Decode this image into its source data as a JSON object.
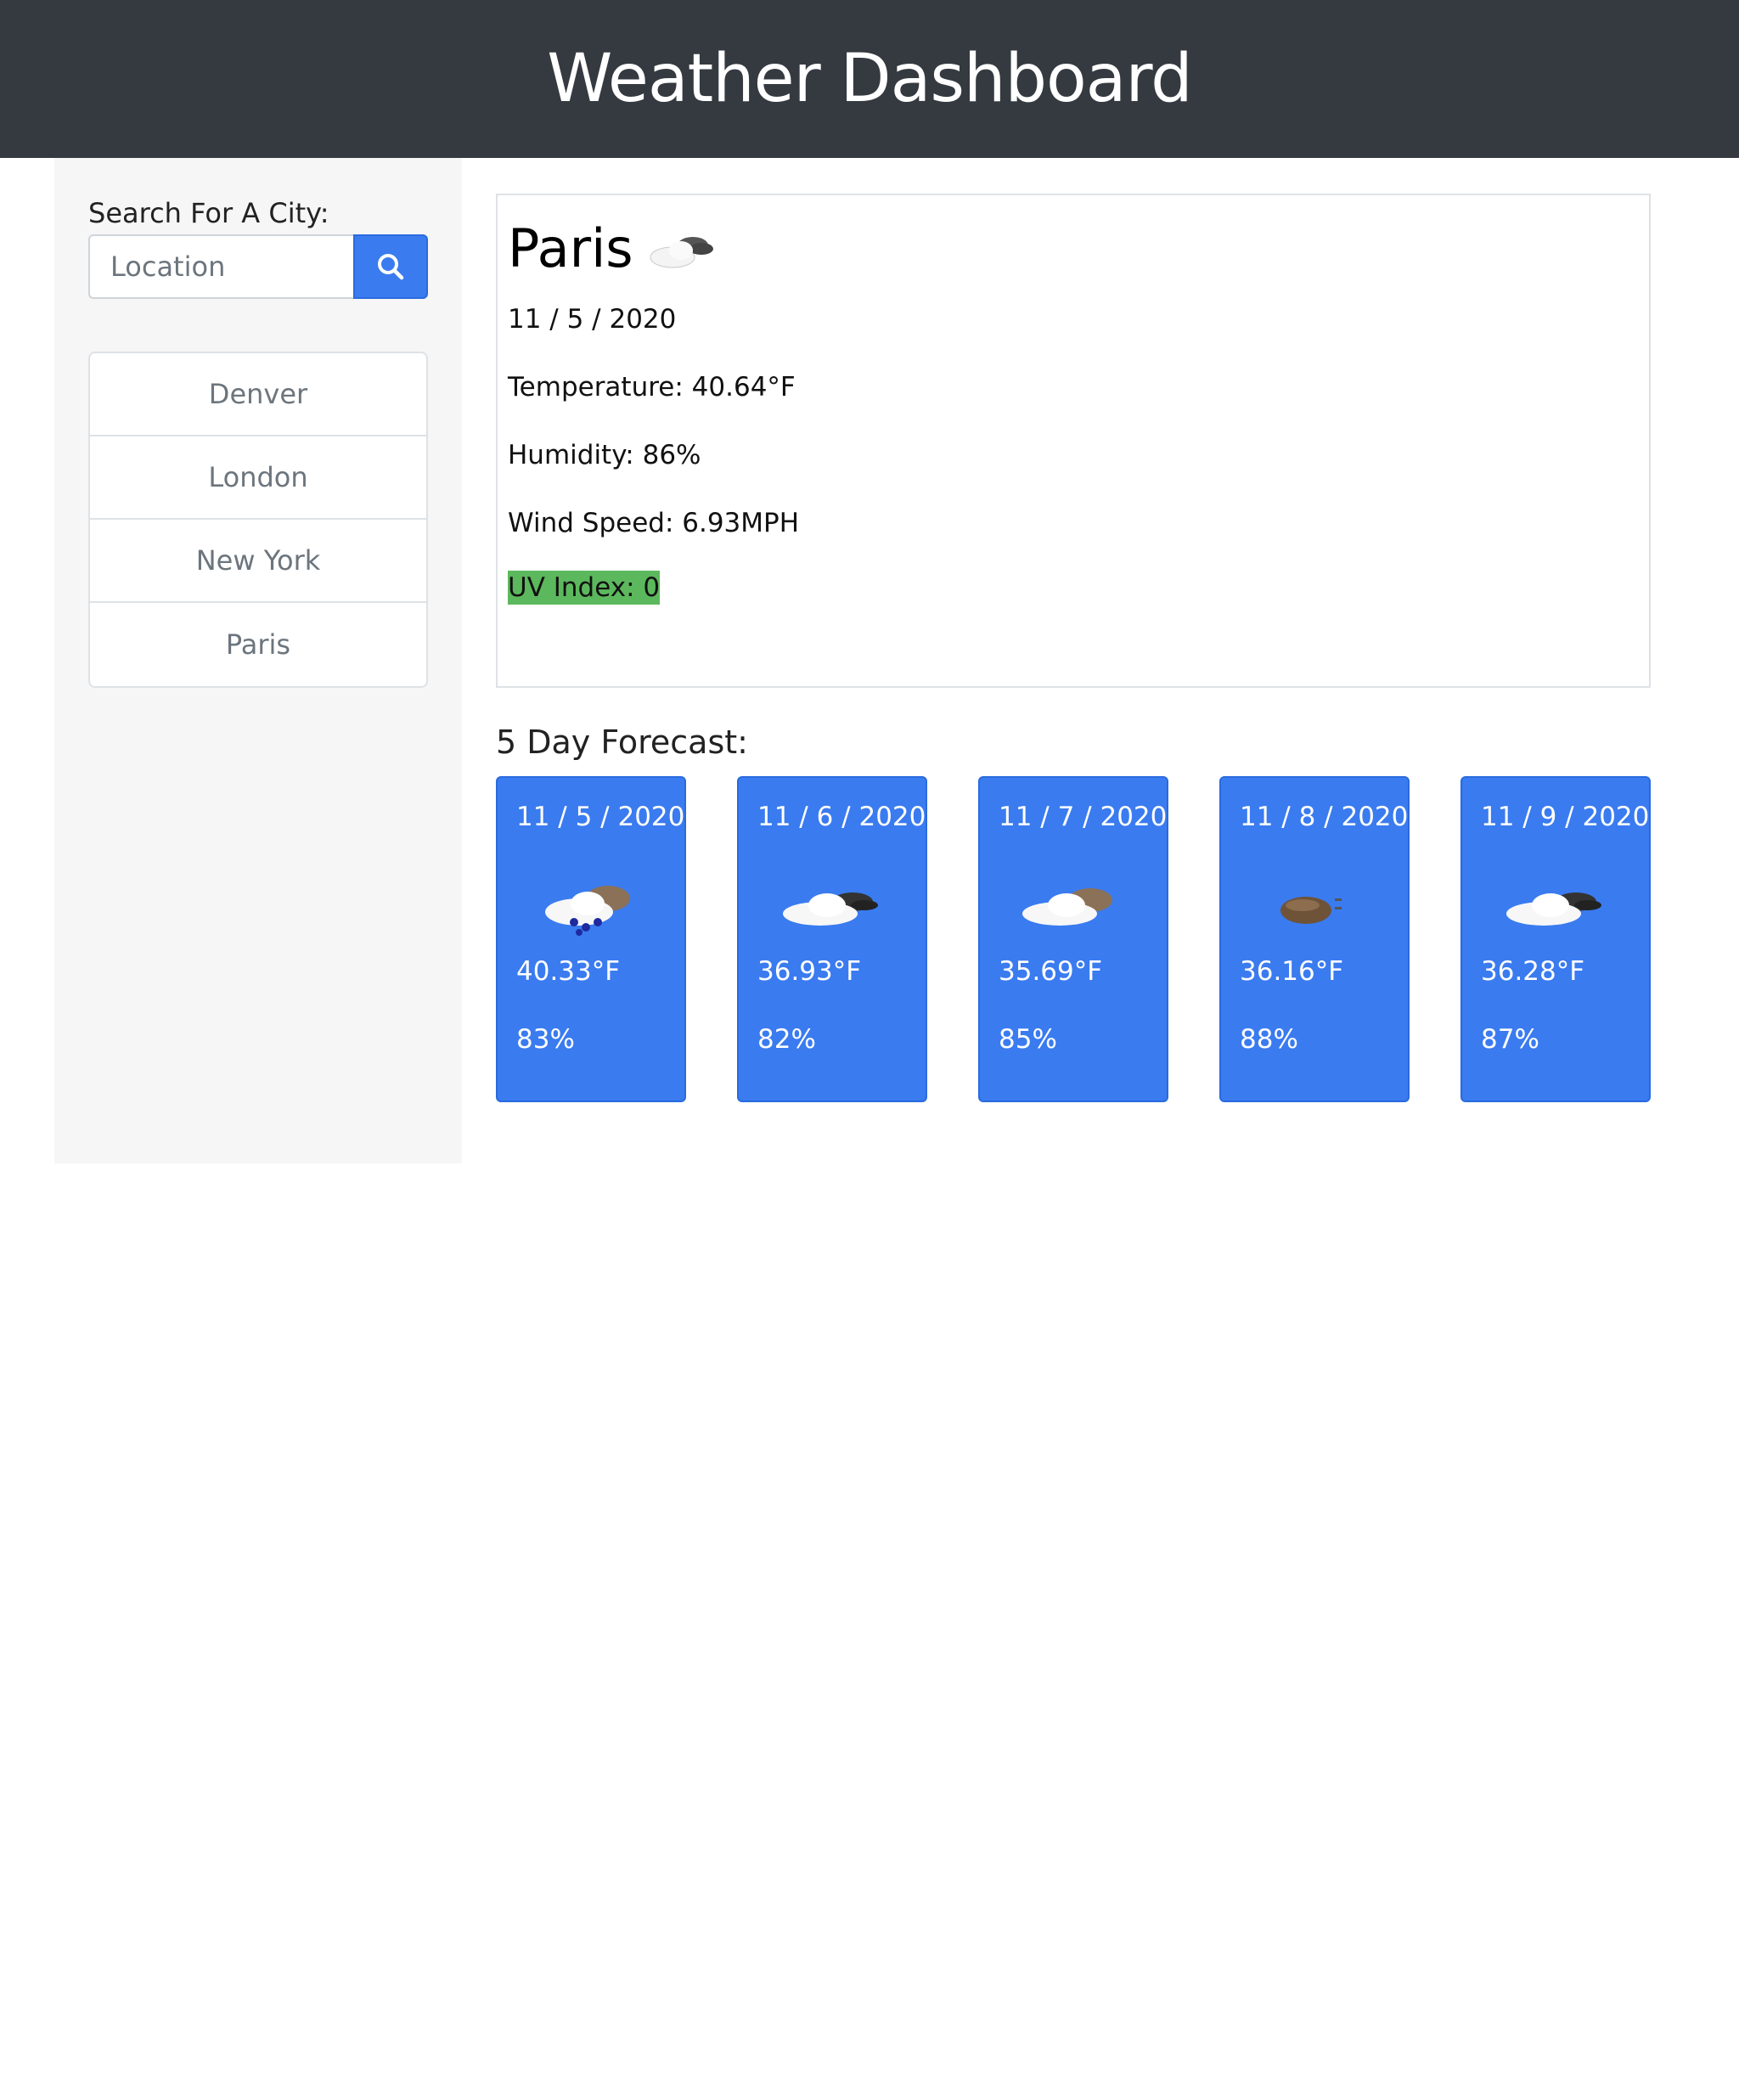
{
  "header": {
    "title": "Weather Dashboard"
  },
  "search": {
    "label": "Search For A City:",
    "placeholder": "Location",
    "button_icon": "search-icon"
  },
  "history": [
    "Denver",
    "London",
    "New York",
    "Paris"
  ],
  "current": {
    "city": "Paris",
    "icon": "partly-cloudy-icon",
    "date": "11 / 5 / 2020",
    "temperature": "Temperature: 40.64°F",
    "humidity": "Humidity: 86%",
    "wind": "Wind Speed: 6.93MPH",
    "uv": "UV Index: 0",
    "uv_color": "#5cb85c"
  },
  "forecast": {
    "title": "5 Day Forecast:",
    "days": [
      {
        "date": "11 / 5 / 2020",
        "icon": "rain-cloud-icon",
        "temp": "40.33°F",
        "humidity": "83%"
      },
      {
        "date": "11 / 6 / 2020",
        "icon": "dark-cloud-icon",
        "temp": "36.93°F",
        "humidity": "82%"
      },
      {
        "date": "11 / 7 / 2020",
        "icon": "brown-cloud-icon",
        "temp": "35.69°F",
        "humidity": "85%"
      },
      {
        "date": "11 / 8 / 2020",
        "icon": "broken-cloud-icon",
        "temp": "36.16°F",
        "humidity": "88%"
      },
      {
        "date": "11 / 9 / 2020",
        "icon": "dark-cloud-icon",
        "temp": "36.28°F",
        "humidity": "87%"
      }
    ]
  },
  "colors": {
    "header_bg": "#343a40",
    "accent": "#3a7bf0",
    "sidebar_bg": "#f6f6f6"
  }
}
